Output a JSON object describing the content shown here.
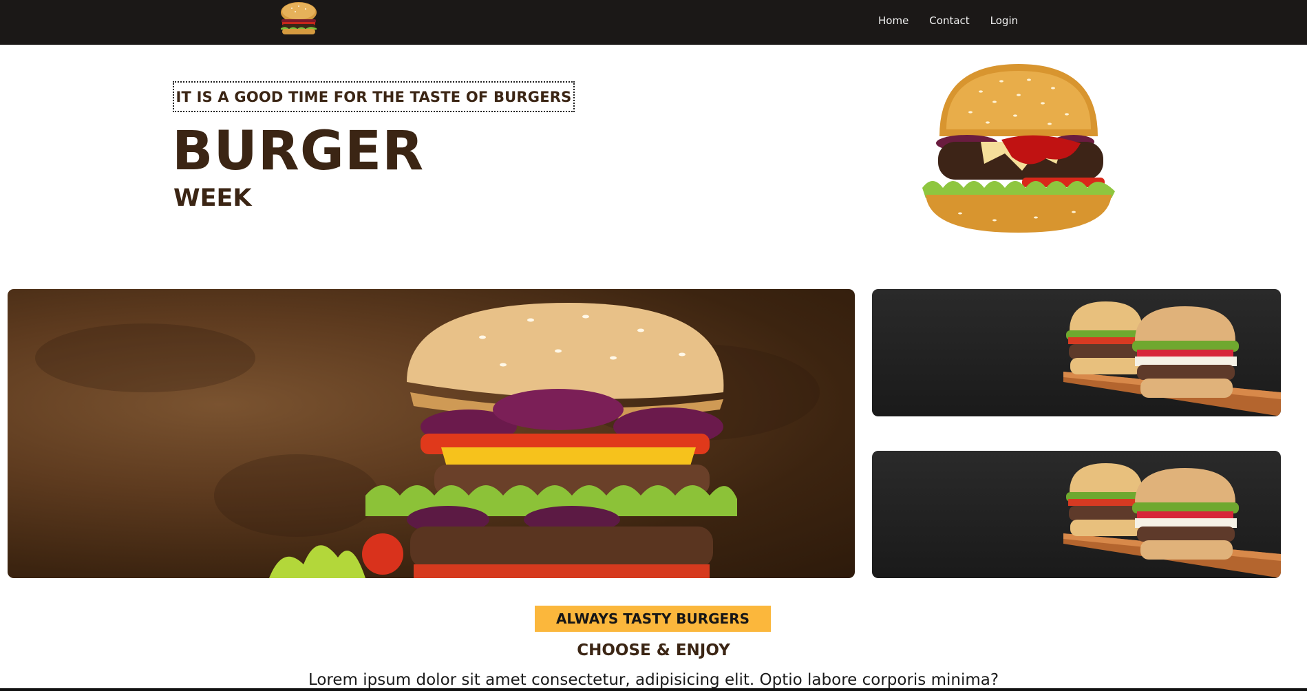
{
  "navbar": {
    "logo_icon": "burger-logo-icon",
    "links": [
      {
        "label": "Home"
      },
      {
        "label": "Contact"
      },
      {
        "label": "Login"
      }
    ],
    "background": "#1b1817"
  },
  "hero": {
    "tagline": "IT IS A GOOD TIME FOR THE TASTE OF BURGERS",
    "title": "BURGER",
    "subtitle": "WEEK",
    "image_icon": "cheeseburger-image"
  },
  "gallery": {
    "main_image": "burger-closeup-photo",
    "side_images": [
      "two-burgers-on-board-photo",
      "two-burgers-on-board-photo"
    ]
  },
  "promo": {
    "badge": "ALWAYS TASTY BURGERS",
    "title": "CHOOSE & ENJOY",
    "body": "Lorem ipsum dolor sit amet consectetur, adipisicing elit. Optio labore corporis minima?"
  },
  "colors": {
    "accent": "#fbb73c",
    "heading": "#3b2514",
    "nav_bg": "#1b1817"
  }
}
